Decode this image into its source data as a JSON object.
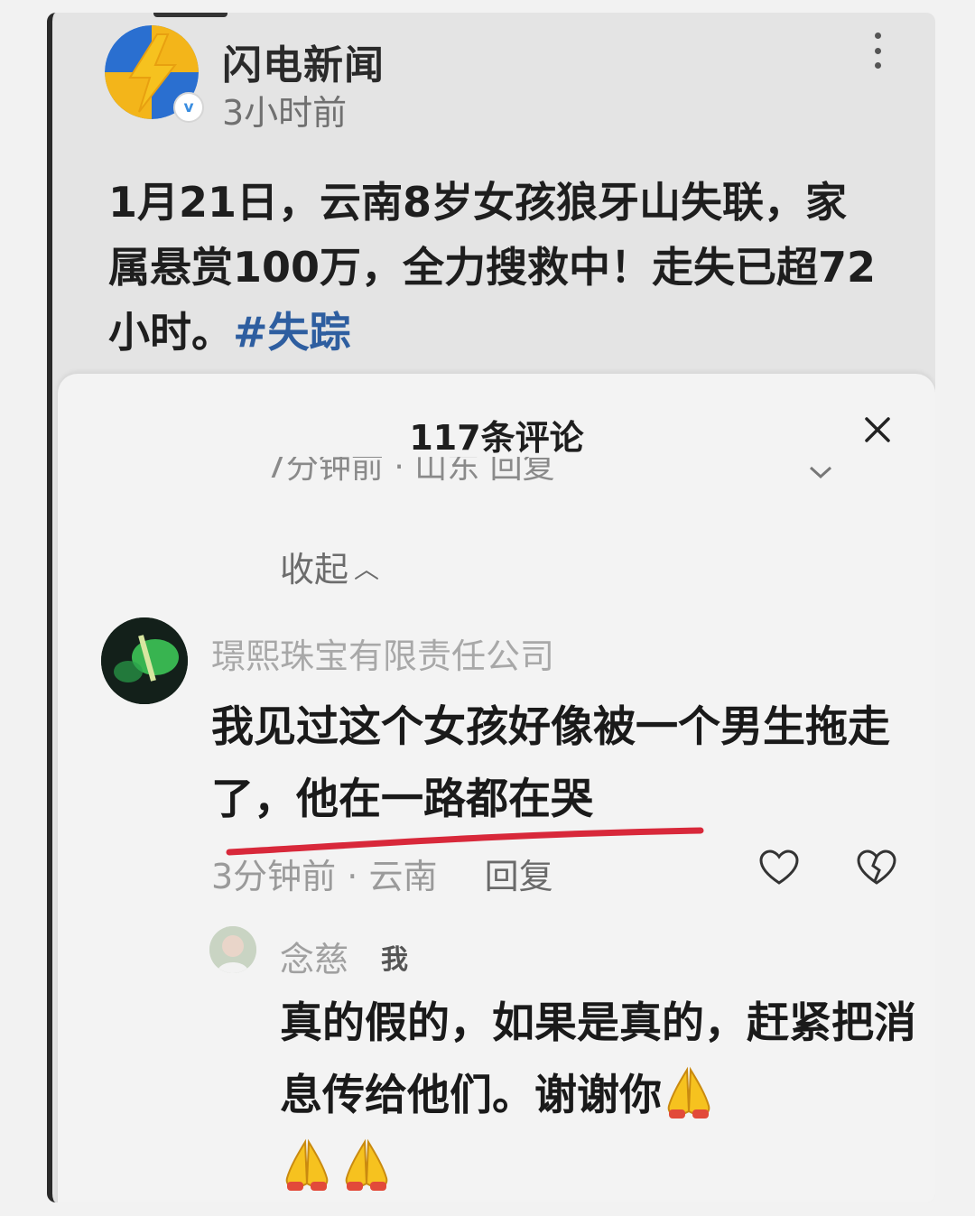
{
  "post": {
    "publisher": "闪电新闻",
    "time": "3小时前",
    "verified_mark": "v",
    "text": "1月21日，云南8岁女孩狼牙山失联，家属悬赏100万，全力搜救中！走失已超72小时。",
    "hashtag": "#失踪"
  },
  "comments_sheet": {
    "title": "117条评论",
    "partial_row_text": "7分钟前 · 山东   回复",
    "collapse_label": "收起",
    "comment": {
      "user": "璟熙珠宝有限责任公司",
      "text": "我见过这个女孩好像被一个男生拖走了，他在一路都在哭",
      "time": "3分钟前",
      "location": "云南",
      "reply_label": "回复"
    },
    "reply": {
      "user": "念慈",
      "badge": "我",
      "text": "真的假的，如果是真的，赶紧把消息传给他们。谢谢你"
    }
  },
  "colors": {
    "hashtag": "#2e5ea0",
    "underline": "#d8283a",
    "logo_yellow": "#f3b51a",
    "logo_blue": "#2a6fd0"
  },
  "icons": [
    "more-vertical-icon",
    "close-icon",
    "heart-icon",
    "dislike-icon",
    "praying-hands-icon",
    "chevron-up-icon",
    "chevron-down-icon"
  ]
}
